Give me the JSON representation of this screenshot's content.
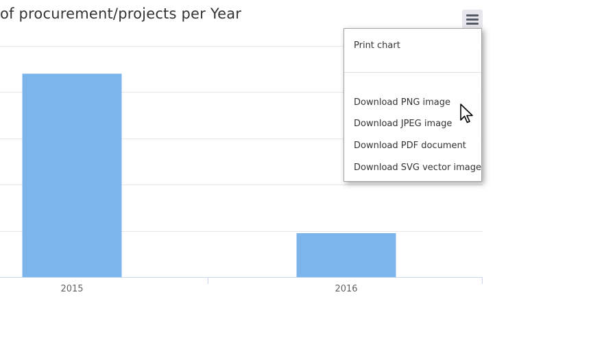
{
  "chart": {
    "title": "of procurement/projects per Year"
  },
  "menu": {
    "print": "Print chart",
    "png": "Download PNG image",
    "jpeg": "Download JPEG image",
    "pdf": "Download PDF document",
    "svg": "Download SVG vector image"
  },
  "icons": {
    "context_button": "hamburger-menu-icon",
    "cursor": "mouse-pointer-icon"
  },
  "colors": {
    "bar": "#7cb5ec",
    "grid": "#e6e6e6",
    "axis": "#ccd6eb"
  },
  "chart_data": {
    "type": "bar",
    "categories": [
      "2015",
      "2016"
    ],
    "values": [
      4.4,
      0.95
    ],
    "title": "of procurement/projects per Year",
    "xlabel": "",
    "ylabel": "",
    "ylim": [
      0,
      5
    ],
    "grid": true
  }
}
